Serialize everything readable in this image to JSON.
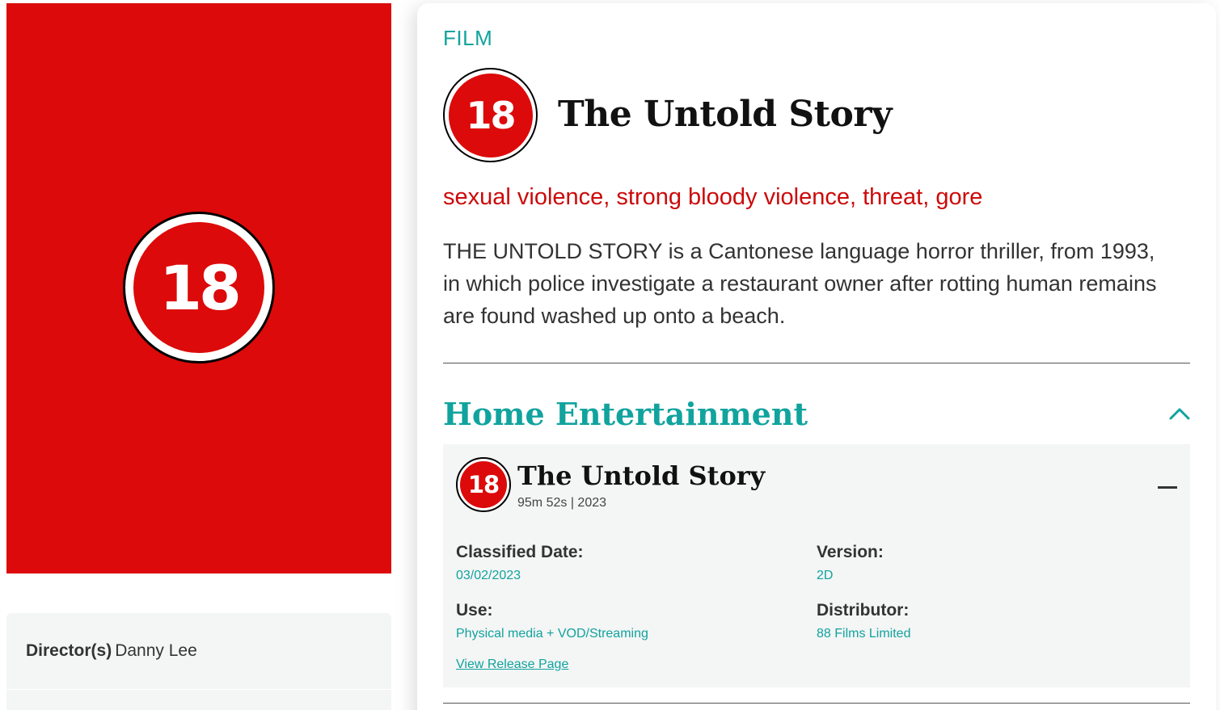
{
  "poster": {
    "rating": "18"
  },
  "credits": {
    "director_label": "Director(s)",
    "director_value": "Danny Lee"
  },
  "film": {
    "kind": "FILM",
    "rating": "18",
    "title": "The Untold Story",
    "warnings": "sexual violence, strong bloody violence, threat, gore",
    "synopsis": "THE UNTOLD STORY is a Cantonese language horror thriller, from 1993, in which police investigate a restaurant owner after rotting human remains are found washed up onto a beach."
  },
  "home_entertainment": {
    "heading": "Home Entertainment",
    "toggle_icon": "chevron-up-icon",
    "release": {
      "rating": "18",
      "title": "The Untold Story",
      "meta": "95m 52s | 2023",
      "collapse_icon": "minus-icon",
      "classified_date_label": "Classified Date:",
      "classified_date": "03/02/2023",
      "version_label": "Version:",
      "version": "2D",
      "use_label": "Use:",
      "use": "Physical media + VOD/Streaming",
      "distributor_label": "Distributor:",
      "distributor": "88 Films Limited",
      "link_label": "View Release Page"
    }
  },
  "colors": {
    "brand_red": "#dc0a0a",
    "accent_teal": "#11a39e",
    "panel_grey": "#f4f5f5"
  }
}
